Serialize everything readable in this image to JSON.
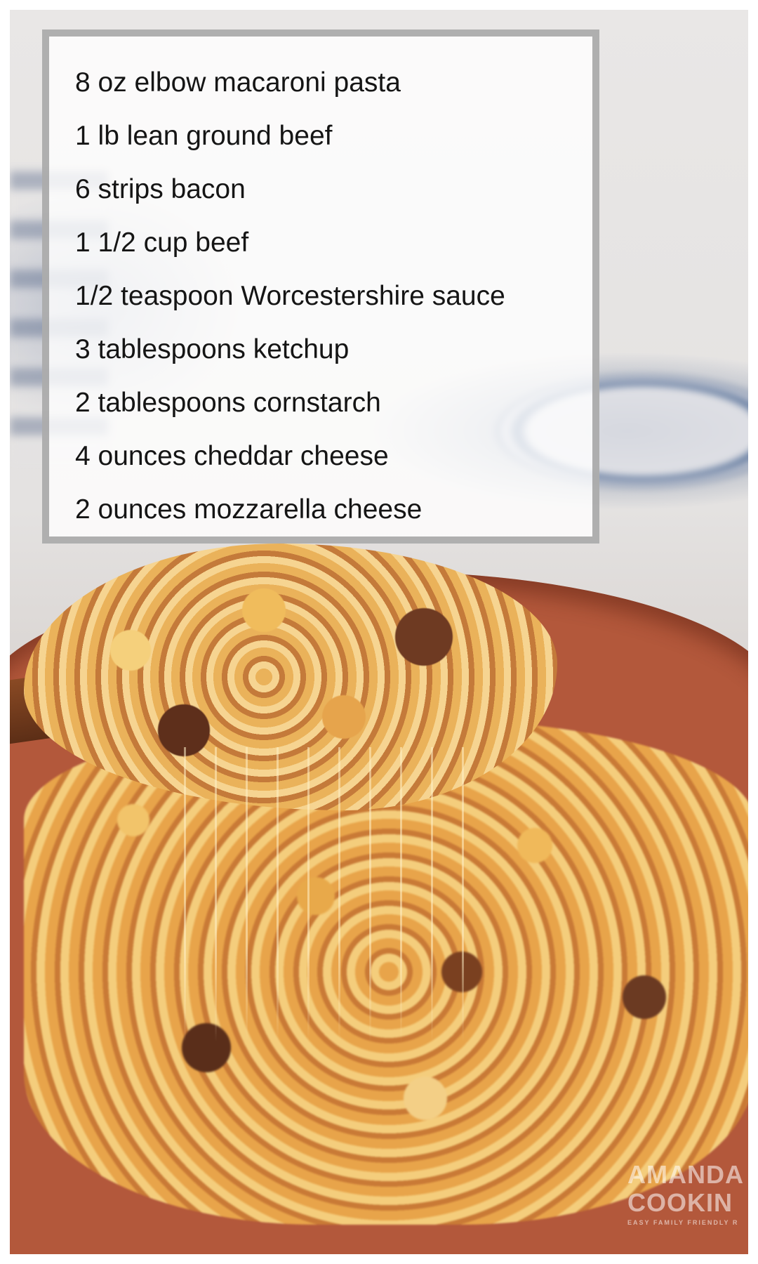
{
  "ingredients": [
    "8 oz elbow macaroni pasta",
    "1 lb lean ground beef",
    "6 strips bacon",
    "1 1/2 cup beef",
    "1/2 teaspoon Worcestershire sauce",
    "3 tablespoons ketchup",
    "2 tablespoons cornstarch",
    "4 ounces cheddar cheese",
    "2 ounces mozzarella cheese"
  ],
  "watermark": {
    "line1": "AMANDA",
    "line2": "COOKIN",
    "line3": "EASY FAMILY FRIENDLY R"
  },
  "colors": {
    "pan": "#b3583b",
    "box_border": "#969696",
    "text": "#151515"
  }
}
